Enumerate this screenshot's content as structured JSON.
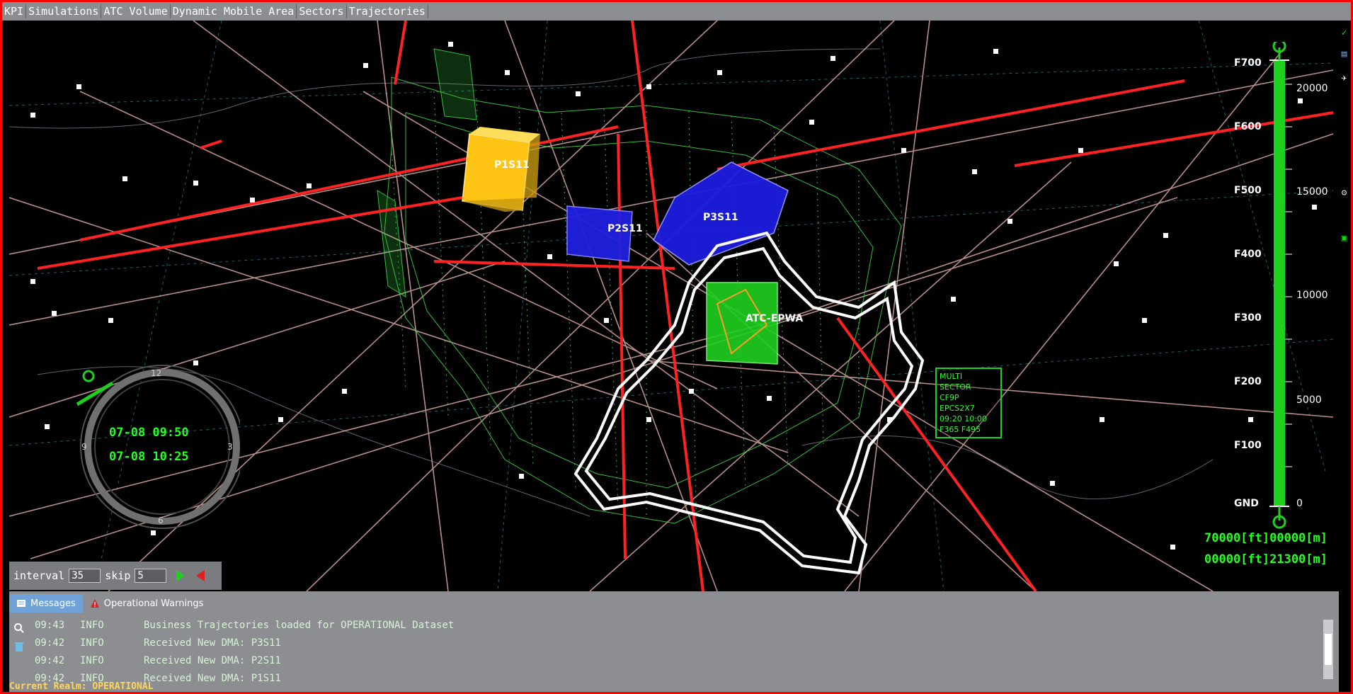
{
  "menu": [
    "KPI",
    "Simulations",
    "ATC Volume",
    "Dynamic Mobile Area",
    "Sectors",
    "Trajectories"
  ],
  "map": {
    "volume_labels": [
      "P1S11",
      "P2S11",
      "P3S11",
      "ATC-EPWA"
    ],
    "sector_info": [
      "MULTI",
      "SECTOR",
      "CF9P",
      "EPCS2X7",
      "09:20 10:00",
      "F365 F495"
    ]
  },
  "time_widget": {
    "start": "07-08 09:50",
    "end": "07-08 10:25",
    "dial_labels": [
      "12",
      "9",
      "3",
      "6"
    ]
  },
  "altitude_scale": {
    "flight_levels": [
      "F700",
      "F600",
      "F500",
      "F400",
      "F300",
      "F200",
      "F100",
      "GND"
    ],
    "feet_ticks": [
      "20000",
      "15000",
      "10000",
      "5000",
      "0"
    ],
    "readout_top": "70000[ft]00000[m]",
    "readout_bottom": "00000[ft]21300[m]",
    "upper_fraction": 1.0,
    "lower_fraction": 0.0
  },
  "playback": {
    "interval_label": "interval",
    "interval_value": "35",
    "skip_label": "skip",
    "skip_value": "5"
  },
  "panel": {
    "tabs": [
      {
        "label": "Messages",
        "icon": "messages-icon"
      },
      {
        "label": "Operational Warnings",
        "icon": "warning-icon"
      }
    ],
    "messages": [
      {
        "time": "09:43",
        "level": "INFO",
        "text": "Business Trajectories loaded for OPERATIONAL Dataset"
      },
      {
        "time": "09:42",
        "level": "INFO",
        "text": "Received New DMA: P3S11"
      },
      {
        "time": "09:42",
        "level": "INFO",
        "text": "Received New DMA: P2S11"
      },
      {
        "time": "09:42",
        "level": "INFO",
        "text": "Received New DMA: P1S11"
      }
    ]
  },
  "status": "Current Realm: OPERATIONAL",
  "colors": {
    "frame": "#ff0000",
    "accent_green": "#23ff23",
    "trajectory_red": "#ff2020",
    "status_yellow": "#ffd75a",
    "tab_blue": "#6fa3d8"
  }
}
